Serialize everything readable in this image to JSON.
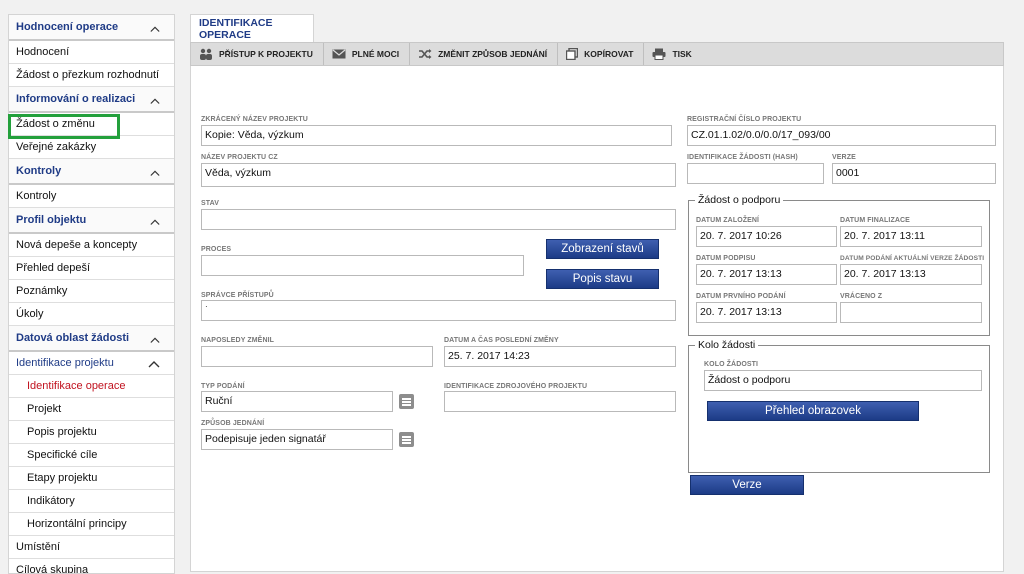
{
  "sidebar": {
    "items": [
      {
        "label": "Hodnocení operace",
        "type": "head"
      },
      {
        "label": "Hodnocení",
        "type": "item"
      },
      {
        "label": "Žádost o přezkum rozhodnutí",
        "type": "item"
      },
      {
        "label": "Informování o realizaci",
        "type": "head"
      },
      {
        "label": "Žádost o změnu",
        "type": "item"
      },
      {
        "label": "Veřejné zakázky",
        "type": "item"
      },
      {
        "label": "Kontroly",
        "type": "head"
      },
      {
        "label": "Kontroly",
        "type": "item"
      },
      {
        "label": "Profil objektu",
        "type": "head"
      },
      {
        "label": "Nová depeše a koncepty",
        "type": "item"
      },
      {
        "label": "Přehled depeší",
        "type": "item"
      },
      {
        "label": "Poznámky",
        "type": "item"
      },
      {
        "label": "Úkoly",
        "type": "item"
      },
      {
        "label": "Datová oblast žádosti",
        "type": "head"
      },
      {
        "label": "Identifikace projektu",
        "type": "head2"
      },
      {
        "label": "Identifikace operace",
        "type": "sub-active"
      },
      {
        "label": "Projekt",
        "type": "sub"
      },
      {
        "label": "Popis projektu",
        "type": "sub"
      },
      {
        "label": "Specifické cíle",
        "type": "sub"
      },
      {
        "label": "Etapy projektu",
        "type": "sub"
      },
      {
        "label": "Indikátory",
        "type": "sub"
      },
      {
        "label": "Horizontální principy",
        "type": "sub"
      },
      {
        "label": "Umístění",
        "type": "item"
      },
      {
        "label": "Cílová skupina",
        "type": "item"
      }
    ]
  },
  "tab": {
    "label": "IDENTIFIKACE OPERACE"
  },
  "toolbar": {
    "access": "PŘÍSTUP K PROJEKTU",
    "powers": "PLNÉ MOCI",
    "change_method": "ZMĚNIT ZPŮSOB JEDNÁNÍ",
    "copy": "KOPÍROVAT",
    "print": "TISK"
  },
  "form": {
    "short_name_label": "ZKRÁCENÝ NÁZEV PROJEKTU",
    "short_name": "Kopie: Věda, výzkum",
    "name_cz_label": "NÁZEV PROJEKTU CZ",
    "name_cz": "Věda, výzkum",
    "state_label": "STAV",
    "state": "",
    "process_label": "PROCES",
    "process": "",
    "access_admin_label": "SPRÁVCE PŘÍSTUPŮ",
    "access_admin": "·",
    "last_changed_by_label": "NAPOSLEDY ZMĚNIL",
    "last_changed_by": "",
    "last_change_label": "DATUM A ČAS POSLEDNÍ ZMĚNY",
    "last_change": "25. 7. 2017 14:23",
    "submission_type_label": "TYP PODÁNÍ",
    "submission_type": "Ruční",
    "source_project_label": "IDENTIFIKACE ZDROJOVÉHO PROJEKTU",
    "source_project": "",
    "acting_method_label": "ZPŮSOB JEDNÁNÍ",
    "acting_method": "Podepisuje jeden signatář",
    "reg_number_label": "REGISTRAČNÍ ČÍSLO PROJEKTU",
    "reg_number": "CZ.01.1.02/0.0/0.0/17_093/00",
    "hash_label": "IDENTIFIKACE ŽÁDOSTI (HASH)",
    "hash": "",
    "version_label": "VERZE",
    "version": "0001",
    "btn_states": "Zobrazení stavů",
    "btn_state_desc": "Popis stavu",
    "btn_screens": "Přehled obrazovek",
    "btn_version": "Verze"
  },
  "support": {
    "legend": "Žádost o podporu",
    "created_label": "DATUM ZALOŽENÍ",
    "created": "20. 7. 2017 10:26",
    "finalized_label": "DATUM FINALIZACE",
    "finalized": "20. 7. 2017 13:11",
    "signed_label": "DATUM PODPISU",
    "signed": "20. 7. 2017 13:13",
    "current_submit_label": "DATUM PODÁNÍ AKTUÁLNÍ VERZE ŽÁDOSTI",
    "current_submit": "20. 7. 2017 13:13",
    "first_submit_label": "DATUM PRVNÍHO PODÁNÍ",
    "first_submit": "20. 7. 2017 13:13",
    "returned_label": "VRÁCENO Z",
    "returned": ""
  },
  "round": {
    "legend": "Kolo žádosti",
    "round_label": "KOLO ŽÁDOSTI",
    "round": "Žádost o podporu"
  },
  "colors": {
    "accent": "#1f3b86",
    "active": "#c1121f",
    "highlight": "#23a03c"
  }
}
